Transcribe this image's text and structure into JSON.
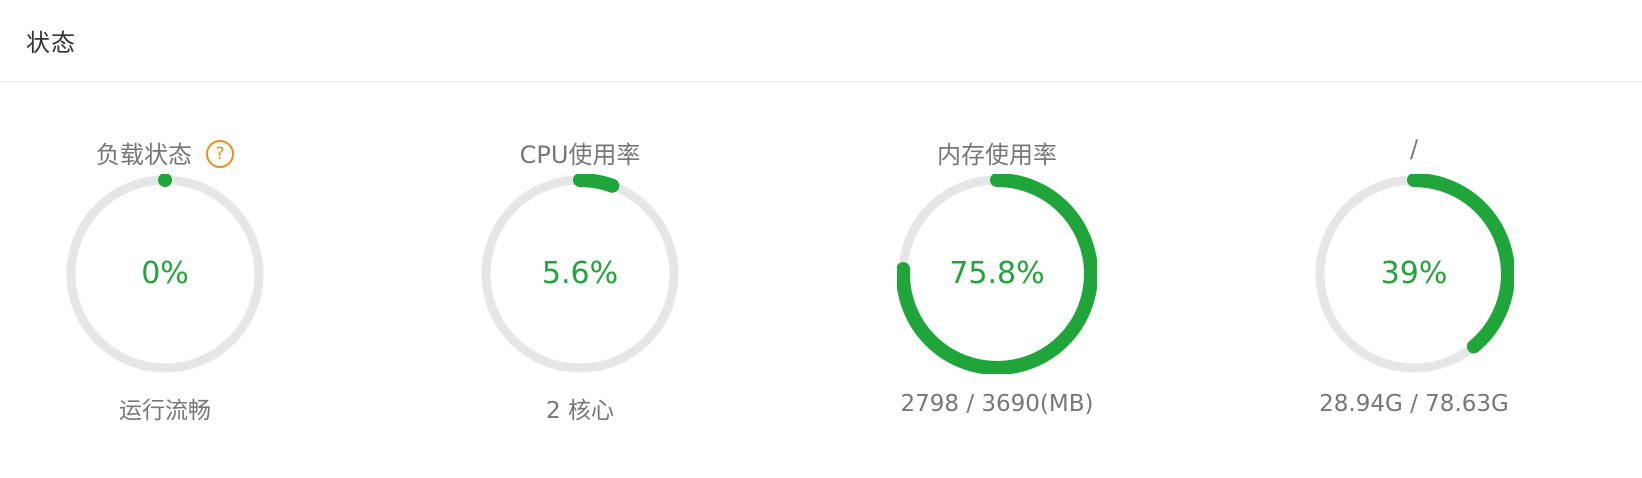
{
  "panel": {
    "title": "状态"
  },
  "colors": {
    "track": "#e6e6e6",
    "progress": "#20a53a",
    "help_icon": "#f0891e"
  },
  "cards": [
    {
      "label": "负载状态",
      "help_icon": "question-circle-icon",
      "help_glyph": "?",
      "value": "0%",
      "percent": 0,
      "sub": "运行流畅"
    },
    {
      "label": "CPU使用率",
      "value": "5.6%",
      "percent": 5.6,
      "sub": "2 核心"
    },
    {
      "label": "内存使用率",
      "value": "75.8%",
      "percent": 75.8,
      "sub": "2798 / 3690(MB)"
    },
    {
      "label": "/",
      "value": "39%",
      "percent": 39,
      "sub": "28.94G / 78.63G"
    }
  ]
}
